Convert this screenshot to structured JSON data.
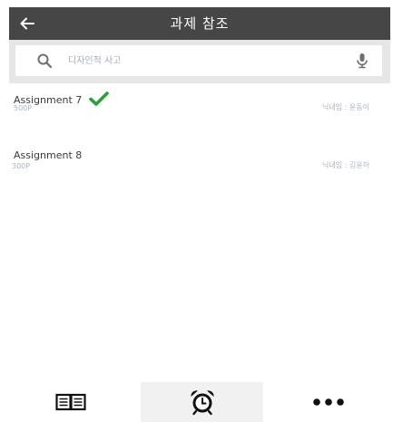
{
  "header": {
    "title": "과제 참조",
    "back_icon": "back-arrow-icon"
  },
  "search": {
    "placeholder": "디자인적 사고",
    "search_icon": "search-icon",
    "mic_icon": "microphone-icon"
  },
  "assignments": [
    {
      "title": "Assignment 7",
      "points": "500P",
      "author": "닉네임 : 윤동이",
      "completed": true
    },
    {
      "title": "Assignment 8",
      "points": "300P",
      "author": "닉네임 : 김윤하",
      "completed": false
    }
  ],
  "bottom_nav": {
    "tabs": [
      {
        "icon": "book-icon",
        "active": false
      },
      {
        "icon": "alarm-clock-icon",
        "active": true
      },
      {
        "icon": "more-dots-icon",
        "active": false
      }
    ]
  },
  "colors": {
    "header_bg": "#464646",
    "search_bg": "#e6e6e6",
    "check_green": "#2e9e3a",
    "muted_text": "#a9b3c2"
  }
}
